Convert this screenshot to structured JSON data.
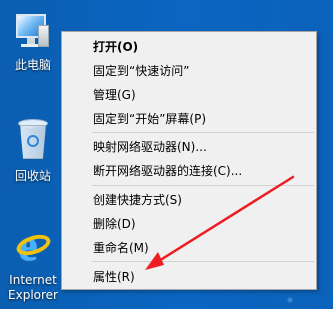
{
  "desktop_icons": [
    {
      "label": "此电脑",
      "icon": "computer-icon"
    },
    {
      "label": "回收站",
      "icon": "recycle-bin-icon"
    },
    {
      "label": "Internet Explorer",
      "line1": "Internet",
      "line2": "Explorer",
      "icon": "internet-explorer-icon"
    }
  ],
  "context_menu": {
    "items": [
      {
        "label": "打开(O)",
        "bold": true
      },
      {
        "label": "固定到“快速访问”"
      },
      {
        "label": "管理(G)"
      },
      {
        "label": "固定到“开始”屏幕(P)"
      },
      {
        "label": "映射网络驱动器(N)..."
      },
      {
        "label": "断开网络驱动器的连接(C)..."
      },
      {
        "label": "创建快捷方式(S)"
      },
      {
        "label": "删除(D)"
      },
      {
        "label": "重命名(M)"
      },
      {
        "label": "属性(R)"
      }
    ]
  },
  "annotation": {
    "arrow_color": "#ee1d24",
    "arrow_target": "属性(R)"
  },
  "colors": {
    "desktop_blue": "#0a64bd",
    "menu_background": "#f0f0f0",
    "menu_border": "#a7a7a7",
    "separator": "#d2d2d2",
    "ie_blue": "#43b2ff",
    "ie_gold": "#f1c10f"
  }
}
